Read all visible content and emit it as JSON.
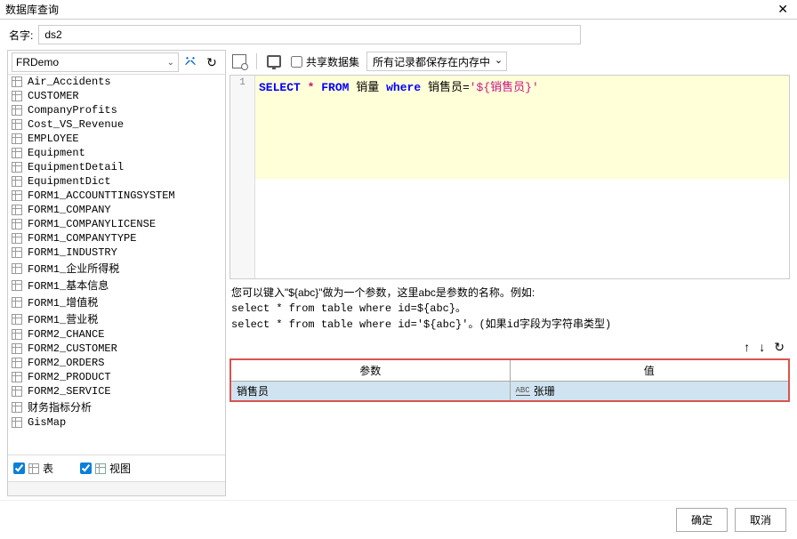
{
  "window": {
    "title": "数据库查询"
  },
  "name": {
    "label": "名字:",
    "value": "ds2"
  },
  "connection": {
    "selected": "FRDemo"
  },
  "tables": [
    "Air_Accidents",
    "CUSTOMER",
    "CompanyProfits",
    "Cost_VS_Revenue",
    "EMPLOYEE",
    "Equipment",
    "EquipmentDetail",
    "EquipmentDict",
    "FORM1_ACCOUNTTINGSYSTEM",
    "FORM1_COMPANY",
    "FORM1_COMPANYLICENSE",
    "FORM1_COMPANYTYPE",
    "FORM1_INDUSTRY",
    "FORM1_企业所得税",
    "FORM1_基本信息",
    "FORM1_增值税",
    "FORM1_营业税",
    "FORM2_CHANCE",
    "FORM2_CUSTOMER",
    "FORM2_ORDERS",
    "FORM2_PRODUCT",
    "FORM2_SERVICE",
    "财务指标分析",
    "GisMap"
  ],
  "filters": {
    "table_label": "表",
    "view_label": "视图"
  },
  "toolbar": {
    "share_label": "共享数据集",
    "memory_option": "所有记录都保存在内存中"
  },
  "sql": {
    "line_no": "1",
    "select": "SELECT",
    "star": "*",
    "from": "FROM",
    "table": "销量",
    "where": "where",
    "cond_field": "销售员=",
    "param": "'${销售员}'"
  },
  "hint": {
    "line1": "您可以键入\"${abc}\"做为一个参数，这里abc是参数的名称。例如:",
    "line2": "select * from table where id=${abc}。",
    "line3": "select * from table where id='${abc}'。(如果id字段为字符串类型)"
  },
  "param": {
    "col_name": "参数",
    "col_value": "值",
    "row_name": "销售员",
    "row_value": "张珊"
  },
  "buttons": {
    "ok": "确定",
    "cancel": "取消"
  }
}
